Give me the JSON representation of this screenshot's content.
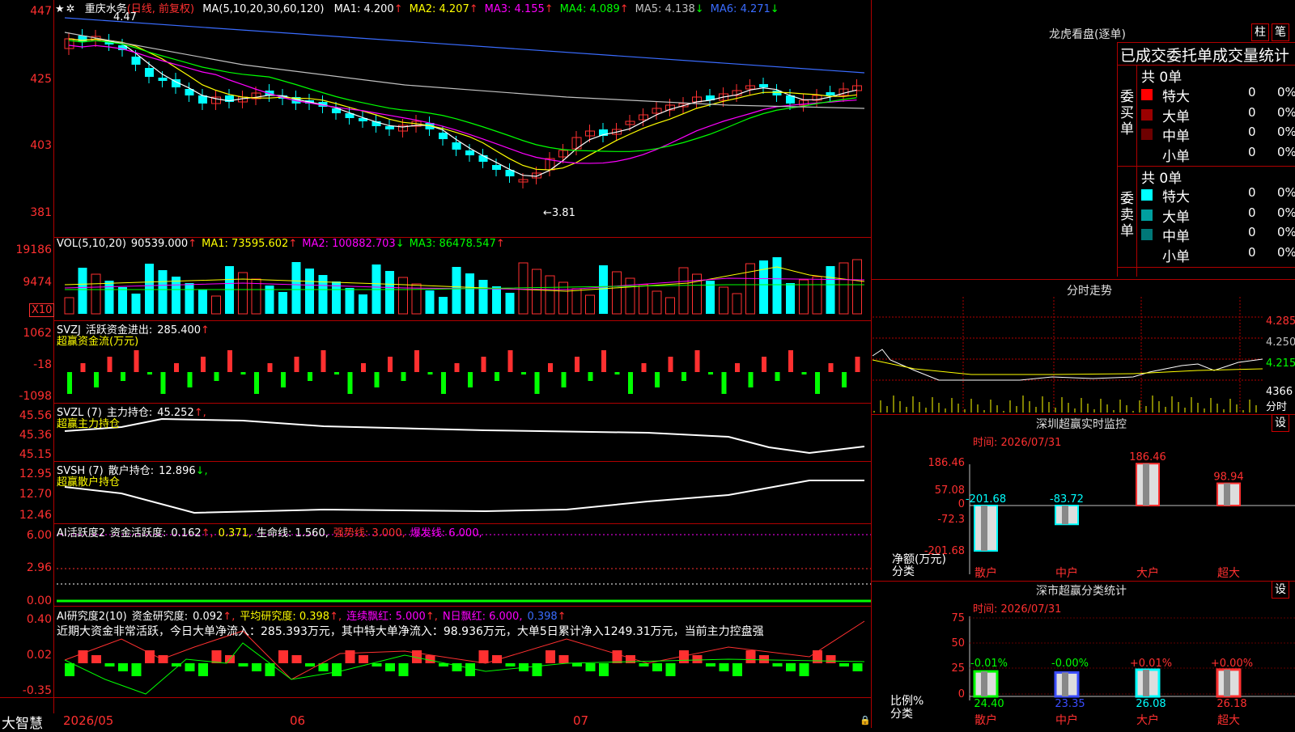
{
  "stock": {
    "name": "重庆水务",
    "period": "(日线, 前复权)"
  },
  "main_chart": {
    "ma_label": "MA(5,10,20,30,60,120)",
    "ma": [
      {
        "name": "MA1:",
        "value": "4.200",
        "arrow": "↑",
        "color": "#ffffff"
      },
      {
        "name": "MA2:",
        "value": "4.207",
        "arrow": "↑",
        "color": "#ffff00"
      },
      {
        "name": "MA3:",
        "value": "4.155",
        "arrow": "↑",
        "color": "#ff00ff"
      },
      {
        "name": "MA4:",
        "value": "4.089",
        "arrow": "↑",
        "color": "#00ff00"
      },
      {
        "name": "MA5:",
        "value": "4.138",
        "arrow": "↓",
        "color": "#c0c0c0"
      },
      {
        "name": "MA6:",
        "value": "4.271",
        "arrow": "↓",
        "color": "#3a6cff"
      }
    ],
    "y_ticks": [
      "447",
      "425",
      "403",
      "381"
    ],
    "high_label": "4.47",
    "low_label": "←3.81"
  },
  "vol": {
    "title": "VOL(5,10,20)",
    "value": "90539.000",
    "arrow": "↑",
    "ma1": "MA1: 73595.602",
    "ma1_arrow": "↑",
    "ma2": "MA2: 100882.703",
    "ma2_arrow": "↓",
    "ma3": "MA3: 86478.547",
    "ma3_arrow": "↑",
    "y_ticks": [
      "19186",
      "9474"
    ],
    "unit": "X10"
  },
  "svzj": {
    "title": "SVZJ",
    "label": "活跃资金进出:",
    "value": "285.400",
    "arrow": "↑",
    "sub": "超赢资金流(万元)",
    "y_ticks": [
      "1062",
      "-18",
      "-1098"
    ]
  },
  "svzl": {
    "title": "SVZL (7)",
    "label": "主力持仓:",
    "value": "45.252",
    "arrow": "↑,",
    "sub": "超赢主力持仓",
    "y_ticks": [
      "45.56",
      "45.36",
      "45.15"
    ]
  },
  "svsh": {
    "title": "SVSH (7)",
    "label": "散户持仓:",
    "value": "12.896",
    "arrow": "↓,",
    "sub": "超赢散户持仓",
    "y_ticks": [
      "12.95",
      "12.70",
      "12.46"
    ]
  },
  "ai_active": {
    "title": "AI活跃度2",
    "label": "资金活跃度:",
    "v1": "0.162",
    "a1": "↑,",
    "v2": "0.371,",
    "life": "生命线: 1.560,",
    "strong": "强势线: 3.000,",
    "burst": "爆发线: 6.000,",
    "y_ticks": [
      "6.00",
      "2.96",
      "0.00"
    ]
  },
  "ai_research": {
    "title": "AI研究度2(10)",
    "label": "资金研究度:",
    "v1": "0.092",
    "a1": "↑,",
    "avg": "平均研究度: 0.398",
    "avg_arrow": "↑,",
    "red": "连续飘红: 5.000",
    "red_arrow": "↑,",
    "nday": "N日飘红: 6.000,",
    "v_last": "0.398",
    "v_last_arrow": "↑",
    "comment": "近期大资金非常活跃，今日大单净流入：285.393万元，其中特大单净流入：98.936万元，大单5日累计净入1249.31万元，当前主力控盘强",
    "y_ticks": [
      "0.40",
      "0.02",
      "-0.35"
    ]
  },
  "x_axis": {
    "labels": [
      "2026/05",
      "06",
      "07"
    ],
    "brand": "大智慧"
  },
  "right": {
    "dragon_title": "龙虎看盘(逐单)",
    "btn_zhu": "柱",
    "btn_bi": "笔",
    "stats_title": "已成交委托单成交量统计",
    "buy": {
      "side": "委买单",
      "total": "共 0单",
      "rows": [
        {
          "name": "特大",
          "count": "0",
          "pct": "0%",
          "color": "#ff0000"
        },
        {
          "name": "大单",
          "count": "0",
          "pct": "0%",
          "color": "#9b0000"
        },
        {
          "name": "中单",
          "count": "0",
          "pct": "0%",
          "color": "#6e0000"
        },
        {
          "name": "小单",
          "count": "0",
          "pct": "0%",
          "color": "#000000"
        }
      ]
    },
    "sell": {
      "side": "委卖单",
      "total": "共 0单",
      "rows": [
        {
          "name": "特大",
          "count": "0",
          "pct": "0%",
          "color": "#00ffff"
        },
        {
          "name": "大单",
          "count": "0",
          "pct": "0%",
          "color": "#00a0a0"
        },
        {
          "name": "中单",
          "count": "0",
          "pct": "0%",
          "color": "#007878"
        },
        {
          "name": "小单",
          "count": "0",
          "pct": "0%",
          "color": "#000000"
        }
      ]
    },
    "intraday": {
      "title": "分时走势",
      "y": [
        "4.285",
        "4.250",
        "4.215"
      ],
      "vol": "4366",
      "vol_label": "分时"
    },
    "monitor": {
      "title": "深圳超赢实时监控",
      "btn": "设",
      "time": "时间: 2026/07/31",
      "y": [
        "186.46",
        "57.08",
        "0",
        "-72.3",
        "-201.68"
      ],
      "bars": [
        {
          "label": "散户",
          "value": "-201.68"
        },
        {
          "label": "中户",
          "value": "-83.72"
        },
        {
          "label": "大户",
          "value": "186.46"
        },
        {
          "label": "超大",
          "value": "98.94"
        }
      ],
      "left_label": "净额(万元)",
      "left_label2": "分类"
    },
    "classify": {
      "title": "深市超赢分类统计",
      "btn": "设",
      "time": "时间: 2026/07/31",
      "y": [
        "75",
        "50",
        "25",
        "0"
      ],
      "bars": [
        {
          "label": "散户",
          "top": "-0.01%",
          "bottom": "24.40"
        },
        {
          "label": "中户",
          "top": "-0.00%",
          "bottom": "23.35"
        },
        {
          "label": "大户",
          "top": "+0.01%",
          "bottom": "26.08"
        },
        {
          "label": "超大",
          "top": "+0.00%",
          "bottom": "26.18"
        }
      ],
      "left_label": "比例%",
      "left_label2": "分类"
    }
  }
}
